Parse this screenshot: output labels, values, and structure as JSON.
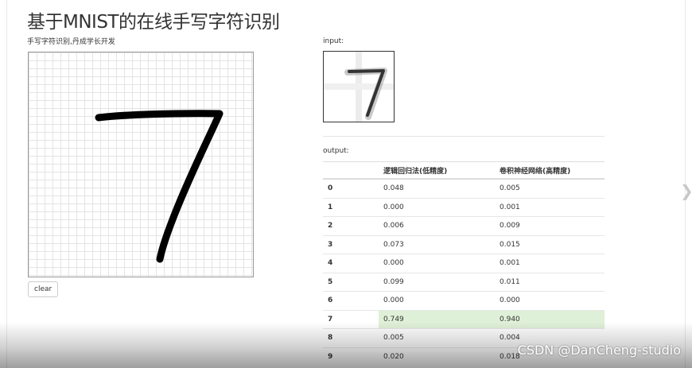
{
  "header": {
    "title": "基于MNIST的在线手写字符识别",
    "subtitle": "手写字符识别,丹成学长开发"
  },
  "input_panel": {
    "label": "input:"
  },
  "controls": {
    "clear_label": "clear"
  },
  "output_panel": {
    "label": "output:",
    "columns": [
      "",
      "逻辑回归法(低精度)",
      "卷积神经网络(高精度)"
    ],
    "rows": [
      {
        "digit": "0",
        "lr": "0.048",
        "cnn": "0.005"
      },
      {
        "digit": "1",
        "lr": "0.000",
        "cnn": "0.001"
      },
      {
        "digit": "2",
        "lr": "0.006",
        "cnn": "0.009"
      },
      {
        "digit": "3",
        "lr": "0.073",
        "cnn": "0.015"
      },
      {
        "digit": "4",
        "lr": "0.000",
        "cnn": "0.001"
      },
      {
        "digit": "5",
        "lr": "0.099",
        "cnn": "0.011"
      },
      {
        "digit": "6",
        "lr": "0.000",
        "cnn": "0.000"
      },
      {
        "digit": "7",
        "lr": "0.749",
        "cnn": "0.940",
        "highlight": true
      },
      {
        "digit": "8",
        "lr": "0.005",
        "cnn": "0.004"
      },
      {
        "digit": "9",
        "lr": "0.020",
        "cnn": "0.018"
      }
    ]
  },
  "watermark": "CSDN @DanCheng-studio",
  "colors": {
    "highlight": "#dff0d8",
    "grid": "#e4e4e4",
    "stroke": "#000000"
  }
}
